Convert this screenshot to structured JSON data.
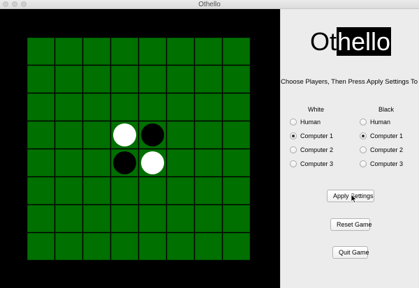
{
  "window": {
    "title": "Othello"
  },
  "board": {
    "cell_color": "#007000",
    "border_color": "#000000",
    "discs": [
      {
        "row": 3,
        "col": 3,
        "color": "white"
      },
      {
        "row": 3,
        "col": 4,
        "color": "black"
      },
      {
        "row": 4,
        "col": 3,
        "color": "black"
      },
      {
        "row": 4,
        "col": 4,
        "color": "white"
      }
    ]
  },
  "panel": {
    "logo_prefix": "Ot",
    "logo_highlight": "hello",
    "instructions": "Choose Players, Then Press Apply Settings To Begin",
    "white_heading": "White",
    "black_heading": "Black",
    "white_options": [
      {
        "label": "Human",
        "checked": false
      },
      {
        "label": "Computer 1",
        "checked": true
      },
      {
        "label": "Computer 2",
        "checked": false
      },
      {
        "label": "Computer 3",
        "checked": false
      }
    ],
    "black_options": [
      {
        "label": "Human",
        "checked": false
      },
      {
        "label": "Computer 1",
        "checked": true
      },
      {
        "label": "Computer 2",
        "checked": false
      },
      {
        "label": "Computer 3",
        "checked": false
      }
    ],
    "apply_label": "Apply Settings",
    "reset_label": "Reset Game",
    "quit_label": "Quit Game"
  }
}
